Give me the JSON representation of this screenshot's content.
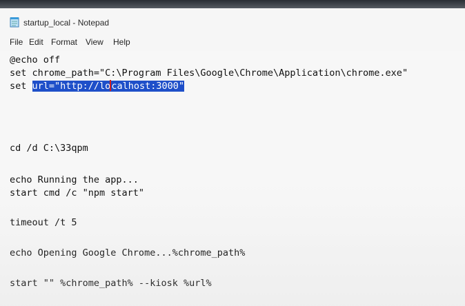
{
  "window": {
    "title": "startup_local - Notepad",
    "icon": "notepad-icon"
  },
  "menu": {
    "items": [
      "File",
      "Edit",
      "Format",
      "View",
      "Help"
    ]
  },
  "editor": {
    "lines": [
      "@echo off",
      "set chrome_path=\"C:\\Program Files\\Google\\Chrome\\Application\\chrome.exe\"",
      "set ",
      "cd /d C:\\33qpm",
      "echo Running the app...",
      "start cmd /c \"npm start\"",
      "timeout /t 5",
      "echo Opening Google Chrome...%chrome_path%",
      "start \"\" %chrome_path% --kiosk %url%"
    ],
    "selection": {
      "before_caret": "url=\"http://lo",
      "after_caret": "calhost:3000\"",
      "highlight_color": "#1e4fc9",
      "caret_color": "#d02020"
    }
  }
}
